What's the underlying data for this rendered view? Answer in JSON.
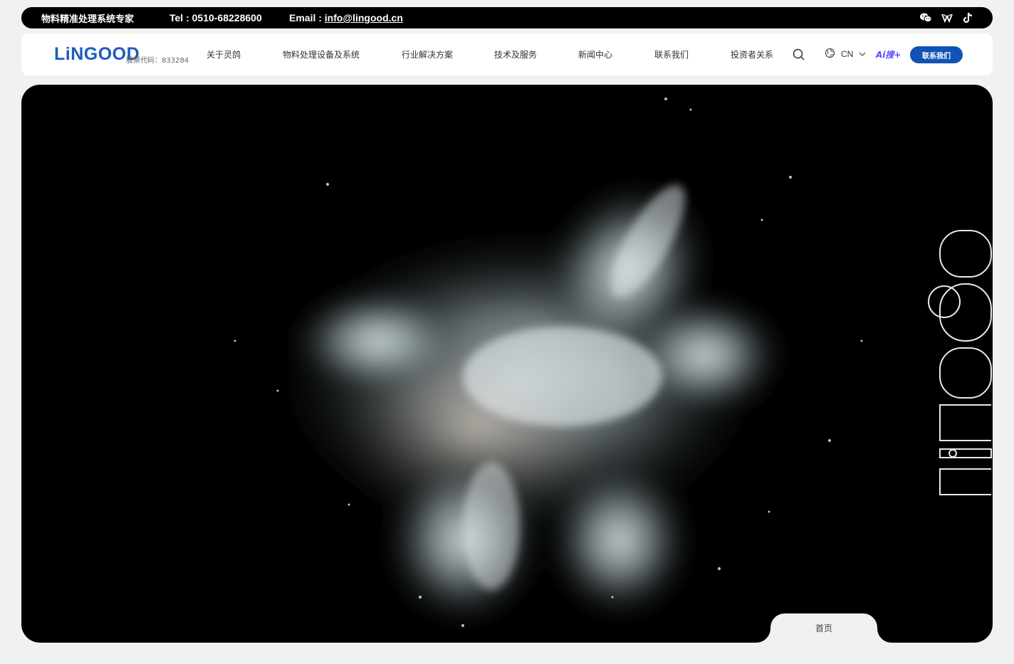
{
  "topbar": {
    "slogan": "物料精准处理系统专家",
    "tel": "Tel : 0510-68228600",
    "email_label": "Email : ",
    "email": "info@lingood.cn",
    "social_icons": [
      "wechat-icon",
      "weibo-icon",
      "tiktok-icon"
    ]
  },
  "header": {
    "logo": "LiNGOOD",
    "stock_code": "股票代码：833284",
    "nav": [
      {
        "label": "关于灵鸽"
      },
      {
        "label": "物料处理设备及系统"
      },
      {
        "label": "行业解决方案"
      },
      {
        "label": "技术及服务"
      },
      {
        "label": "新闻中心"
      },
      {
        "label": "联系我们"
      },
      {
        "label": "投资者关系"
      }
    ],
    "lang": "CN",
    "ai_search": "Ai搜+",
    "contact_button": "联系我们"
  },
  "hero": {
    "vertical_logo": "LiNGOOD",
    "home_tab": "首页"
  },
  "colors": {
    "brand_blue": "#1252b5",
    "logo_blue": "#1a5cbf",
    "ai_purple": "#5a4bff",
    "page_bg": "#f0f1f3"
  }
}
